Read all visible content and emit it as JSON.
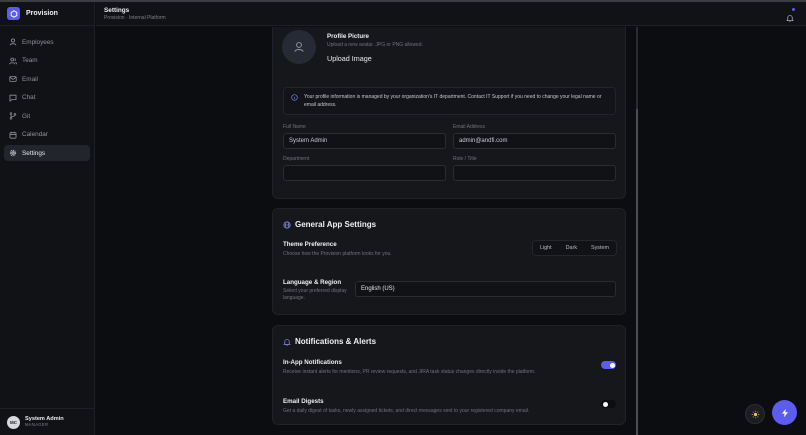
{
  "app": {
    "name": "Provision"
  },
  "sidebar": {
    "items": [
      {
        "label": "Employees",
        "icon": "users-icon",
        "active": false
      },
      {
        "label": "Team",
        "icon": "team-icon",
        "active": false
      },
      {
        "label": "Email",
        "icon": "mail-icon",
        "active": false
      },
      {
        "label": "Chat",
        "icon": "chat-icon",
        "active": false
      },
      {
        "label": "Git",
        "icon": "git-icon",
        "active": false
      },
      {
        "label": "Calendar",
        "icon": "calendar-icon",
        "active": false
      },
      {
        "label": "Settings",
        "icon": "gear-icon",
        "active": true
      }
    ]
  },
  "user": {
    "initials": "MC",
    "name": "System Admin",
    "role": "MANAGER"
  },
  "header": {
    "title": "Settings",
    "subtitle": "Provision · Internal Platform"
  },
  "profile": {
    "picture_title": "Profile Picture",
    "picture_hint": "Upload a new avatar. JPG or PNG allowed.",
    "upload_label": "Upload Image",
    "info_text": "Your profile information is managed by your organization's IT department. Contact IT Support if you need to change your legal name or email address.",
    "fields": {
      "full_name": {
        "label": "Full Name",
        "value": "System Admin"
      },
      "email": {
        "label": "Email Address",
        "value": "admin@andfi.com"
      },
      "department": {
        "label": "Department",
        "value": ""
      },
      "role": {
        "label": "Role / Title",
        "value": ""
      }
    }
  },
  "general": {
    "title": "General App Settings",
    "theme": {
      "title": "Theme Preference",
      "desc": "Choose how the Provision platform looks for you.",
      "options": [
        "Light",
        "Dark",
        "System"
      ]
    },
    "language": {
      "title": "Language & Region",
      "desc": "Select your preferred display language.",
      "value": "English (US)"
    }
  },
  "notifications": {
    "title": "Notifications & Alerts",
    "in_app": {
      "title": "In-App Notifications",
      "desc": "Receive instant alerts for mentions, PR review requests, and JIRA task status changes directly inside the platform.",
      "enabled": true
    },
    "digest": {
      "title": "Email Digests",
      "desc": "Get a daily digest of tasks, newly assigned tickets, and direct messages sent to your registered company email.",
      "enabled": false
    }
  },
  "colors": {
    "accent": "#5b5cf0",
    "background": "#0c0d10",
    "card": "#16171b"
  }
}
